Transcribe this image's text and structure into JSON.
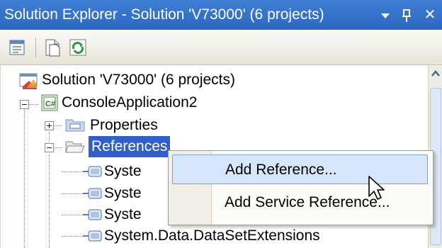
{
  "window": {
    "title": "Solution Explorer - Solution 'V73000' (6 projects)",
    "dropdown_glyph": "▾",
    "pin_glyph": "ꟷ",
    "close_glyph": "✕"
  },
  "toolbar": {
    "buttons": [
      "properties-icon",
      "show-all-files-icon",
      "refresh-icon"
    ]
  },
  "tree": {
    "solution": "Solution 'V73000' (6 projects)",
    "project": "ConsoleApplication2",
    "properties": "Properties",
    "references": "References",
    "ref_items": [
      "Syste",
      "Syste",
      "Syste",
      "System.Data.DataSetExtensions"
    ]
  },
  "context_menu": {
    "items": [
      "Add Reference...",
      "Add Service Reference..."
    ]
  },
  "colors": {
    "title_bar": "#3f7fd4",
    "selection": "#2f5fc7",
    "menu_highlight": "#d6e6fb"
  }
}
